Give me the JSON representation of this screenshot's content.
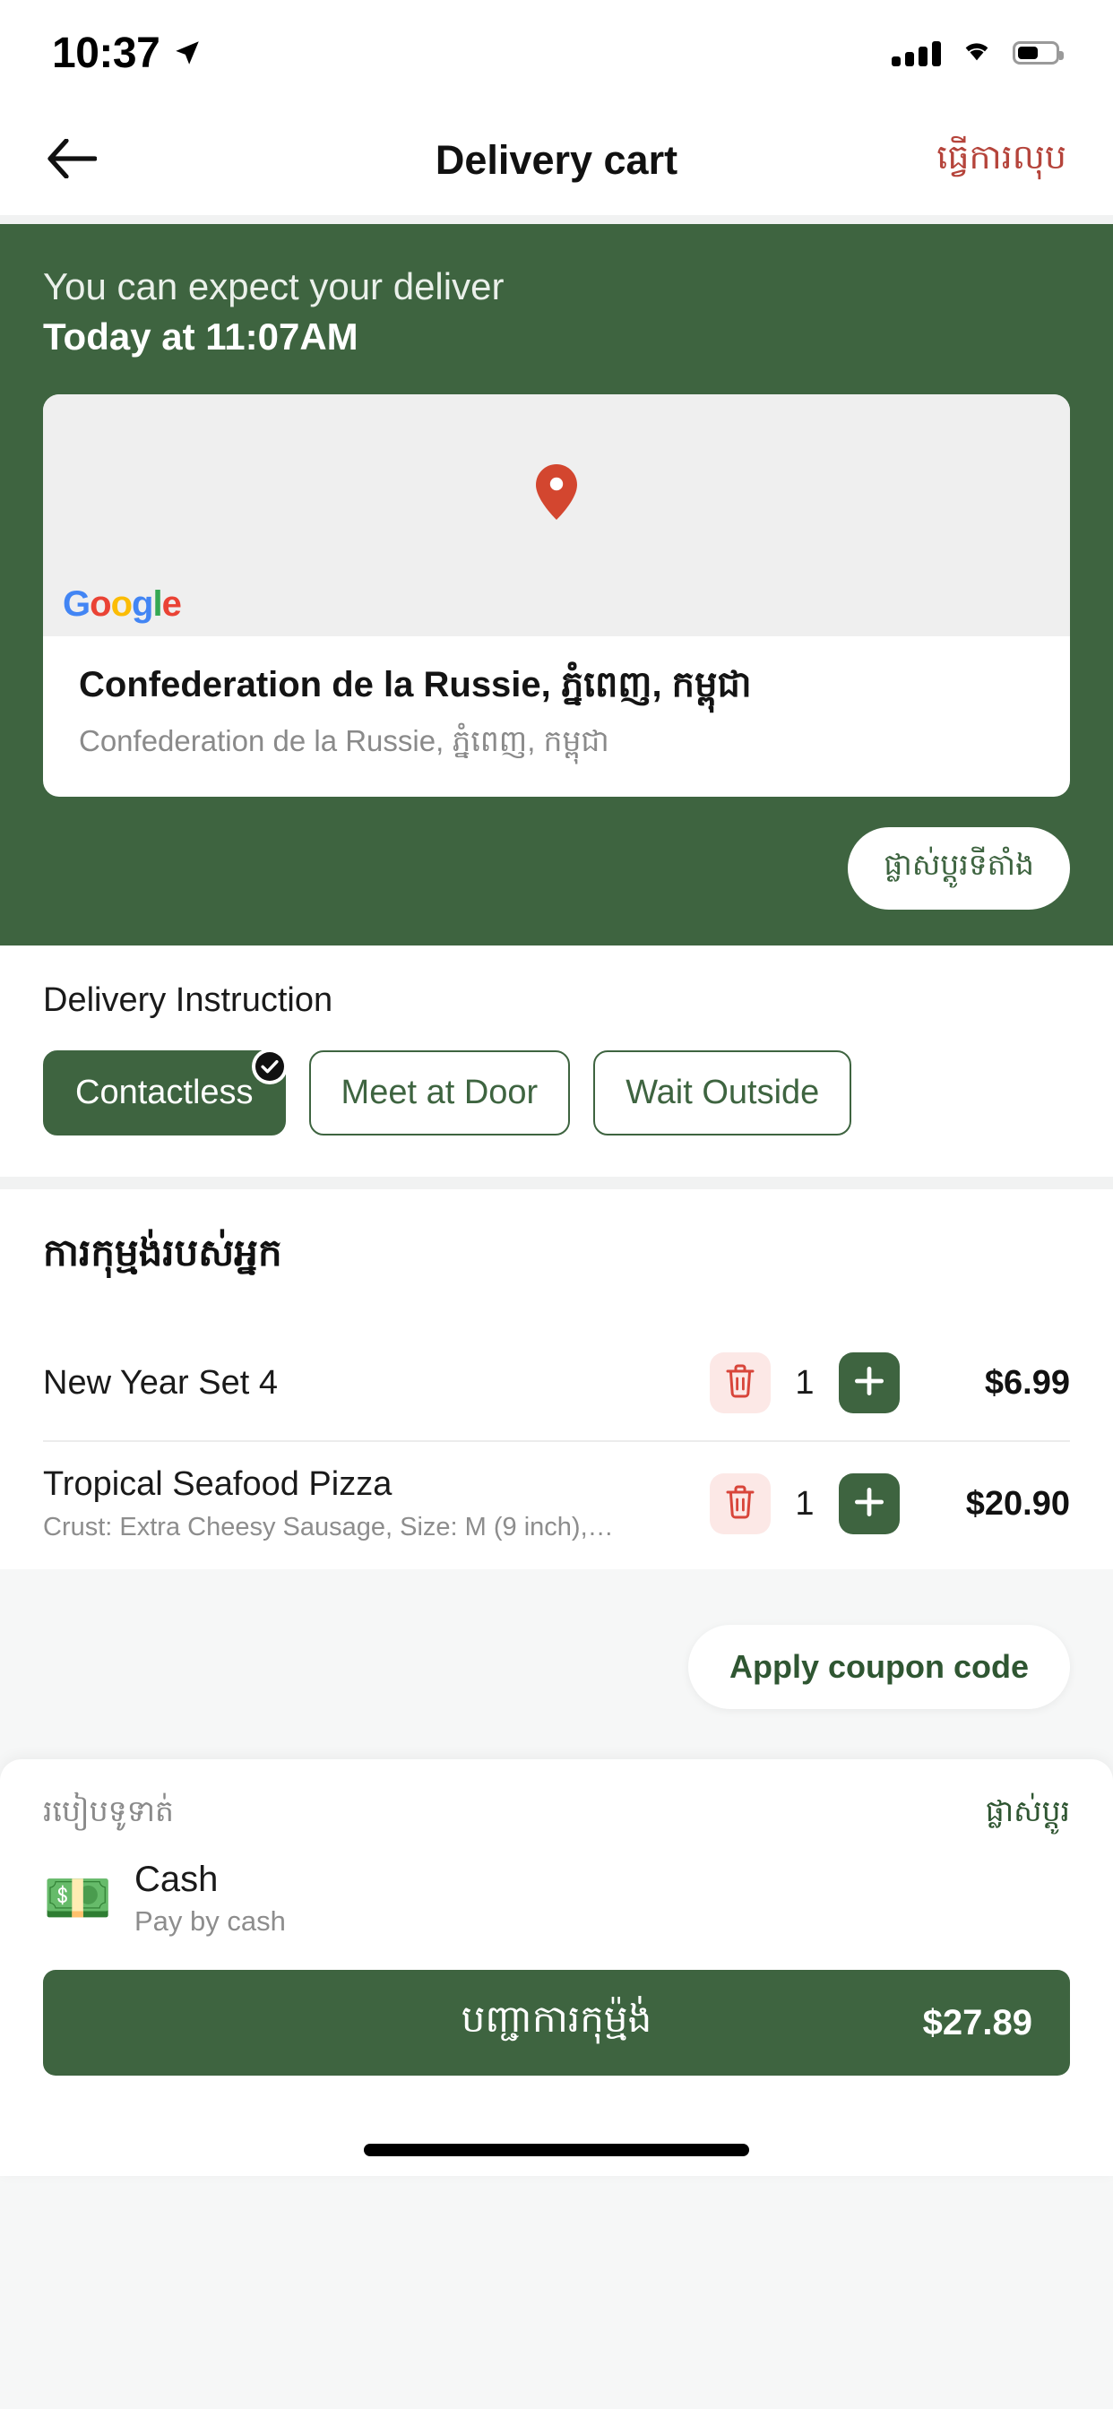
{
  "status_bar": {
    "time": "10:37",
    "location_icon": "location-arrow-icon",
    "signal_icon": "cellular-signal-icon",
    "wifi_icon": "wifi-icon",
    "battery_icon": "battery-icon"
  },
  "header": {
    "back_icon": "arrow-left-icon",
    "title": "Delivery cart",
    "action_label": "ធ្វើការលុប",
    "action_color": "#B5443B"
  },
  "delivery_banner": {
    "background": "#3E6440",
    "line1": "You can expect your deliver",
    "line2": "Today at 11:07AM",
    "map": {
      "pin_icon": "map-pin-icon",
      "pin_color": "#D3462F",
      "attribution": "Google",
      "attribution_letters": [
        "G",
        "o",
        "o",
        "g",
        "l",
        "e"
      ]
    },
    "address_title": "Confederation de la Russie, ភ្នំពេញ, កម្ពុជា",
    "address_subtitle": "Confederation de la Russie, ភ្នំពេញ, កម្ពុជា",
    "change_location_label": "ផ្លាស់ប្ដូរទីតាំង"
  },
  "delivery_instruction": {
    "title": "Delivery Instruction",
    "options": [
      {
        "label": "Contactless",
        "selected": true
      },
      {
        "label": "Meet at Door",
        "selected": false
      },
      {
        "label": "Wait Outside",
        "selected": false
      }
    ]
  },
  "order": {
    "title": "ការកុម្មង់របស់អ្នក",
    "items": [
      {
        "name": "New Year Set 4",
        "options": "",
        "quantity": "1",
        "price": "$6.99",
        "delete_icon": "trash-icon",
        "add_icon": "plus-icon"
      },
      {
        "name": "Tropical Seafood Pizza",
        "options": "Crust: Extra Cheesy Sausage, Size: M (9 inch),…",
        "quantity": "1",
        "price": "$20.90",
        "delete_icon": "trash-icon",
        "add_icon": "plus-icon"
      }
    ]
  },
  "coupon": {
    "label": "Apply coupon code"
  },
  "payment": {
    "section_label": "របៀបទូទាត់",
    "change_label": "ផ្លាស់ប្ដូរ",
    "method_icon": "cash-banknote-icon",
    "method_glyph": "💵",
    "method_name": "Cash",
    "method_desc": "Pay by cash"
  },
  "checkout": {
    "label": "បញ្ជាការកុម្ម៉ង់",
    "total": "$27.89",
    "background": "#3E6440"
  },
  "theme": {
    "primary_green": "#3E6440",
    "danger_red": "#B5443B",
    "page_bg": "#F6F7F7",
    "card_bg": "#FFFFFF"
  }
}
